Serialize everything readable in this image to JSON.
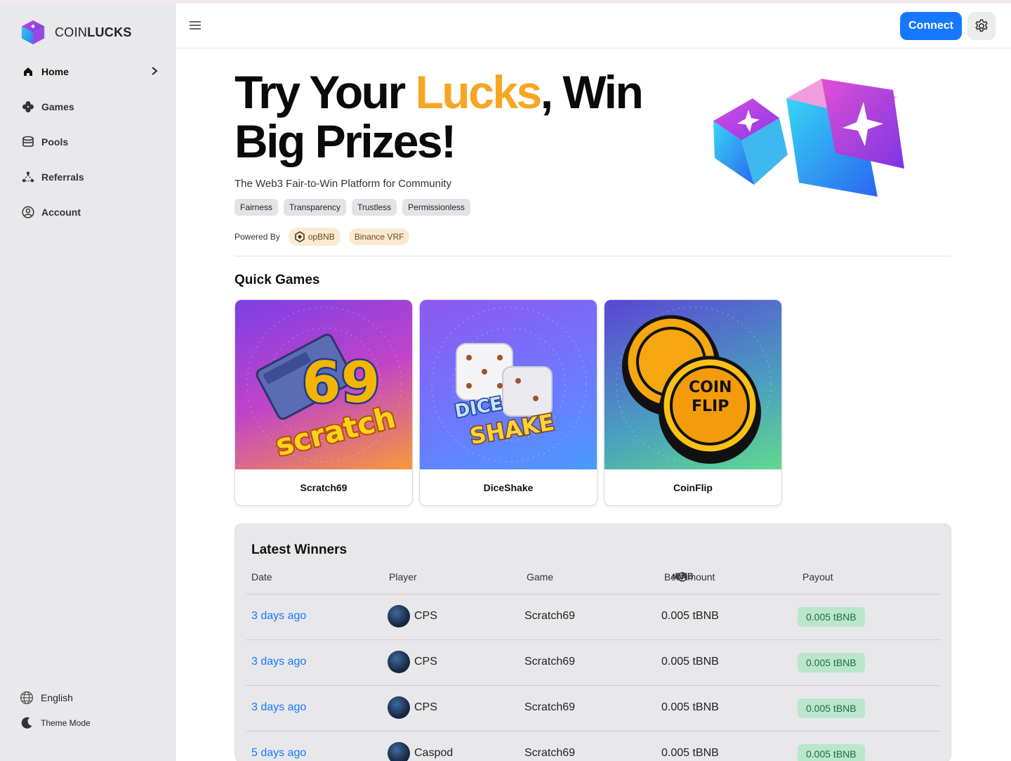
{
  "brand": {
    "name_light": "COIN",
    "name_bold": "LUCKS"
  },
  "nav": [
    {
      "label": "Home",
      "icon": "home-icon",
      "active": true
    },
    {
      "label": "Games",
      "icon": "clover-icon"
    },
    {
      "label": "Pools",
      "icon": "coins-stack-icon"
    },
    {
      "label": "Referrals",
      "icon": "network-icon"
    },
    {
      "label": "Account",
      "icon": "user-circle-icon"
    }
  ],
  "sidebar_bottom": {
    "language": "English",
    "theme": "Theme Mode"
  },
  "topbar": {
    "connect_label": "Connect"
  },
  "hero": {
    "title_part1": "Try Your ",
    "title_accent": "Lucks",
    "title_part2": ", Win Big Prizes!",
    "subtitle": "The Web3 Fair-to-Win Platform for Community",
    "tags": [
      "Fairness",
      "Transparency",
      "Trustless",
      "Permissionless"
    ],
    "powered_by": "Powered By",
    "powered_pills": [
      "opBNB",
      "Binance VRF"
    ],
    "accent_color": "#f6a623"
  },
  "quick_games": {
    "title": "Quick Games",
    "games": [
      "Scratch69",
      "DiceShake",
      "CoinFlip"
    ]
  },
  "winners": {
    "title": "Latest Winners",
    "columns": {
      "date": "Date",
      "player": "Player",
      "game": "Game",
      "bet": "Bet Amount",
      "bet_unit": "tBNB",
      "payout": "Payout"
    },
    "rows": [
      {
        "date": "3 days ago",
        "player": "CPS",
        "game": "Scratch69",
        "bet": "0.005 tBNB",
        "payout": "0.005 tBNB"
      },
      {
        "date": "3 days ago",
        "player": "CPS",
        "game": "Scratch69",
        "bet": "0.005 tBNB",
        "payout": "0.005 tBNB"
      },
      {
        "date": "3 days ago",
        "player": "CPS",
        "game": "Scratch69",
        "bet": "0.005 tBNB",
        "payout": "0.005 tBNB"
      },
      {
        "date": "5 days ago",
        "player": "Caspod",
        "game": "Scratch69",
        "bet": "0.005 tBNB",
        "payout": "0.005 tBNB"
      }
    ]
  },
  "colors": {
    "primary": "#1677ff",
    "payout_bg": "#b9e6cc",
    "payout_text": "#226b45"
  }
}
